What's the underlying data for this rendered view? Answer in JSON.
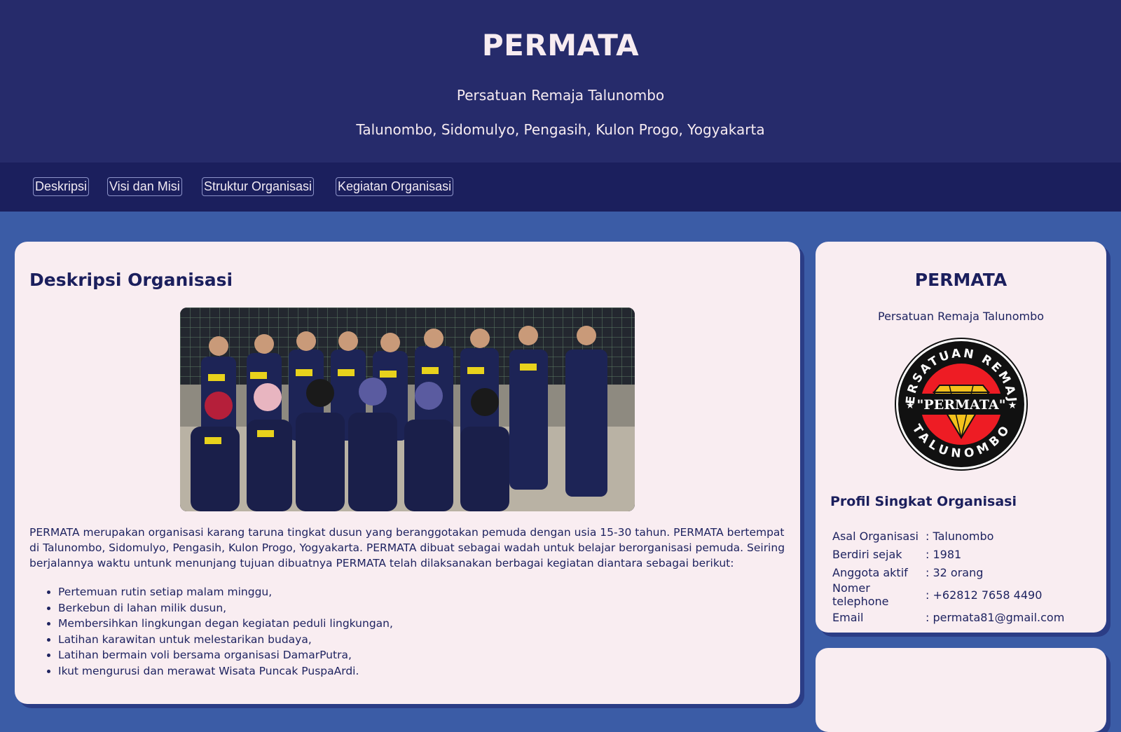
{
  "header": {
    "title": "PERMATA",
    "subtitle": "Persatuan Remaja Talunombo",
    "address": "Talunombo, Sidomulyo, Pengasih, Kulon Progo, Yogyakarta"
  },
  "nav": {
    "items": [
      {
        "label": "Deskripsi"
      },
      {
        "label": "Visi dan Misi"
      },
      {
        "label": "Struktur Organisasi"
      },
      {
        "label": "Kegiatan Organisasi"
      }
    ]
  },
  "main": {
    "title": "Deskripsi Organisasi",
    "description": "PERMATA merupakan organisasi karang taruna tingkat dusun yang beranggotakan pemuda dengan usia 15-30 tahun. PERMATA bertempat di Talunombo, Sidomulyo, Pengasih, Kulon Progo, Yogyakarta. PERMATA dibuat sebagai wadah untuk belajar berorganisasi pemuda. Seiring berjalannya waktu untunk menunjang tujuan dibuatnya PERMATA telah dilaksanakan berbagai kegiatan diantara sebagai berikut:",
    "activities": [
      "Pertemuan rutin setiap malam minggu,",
      "Berkebun di lahan milik dusun,",
      "Membersihkan lingkungan degan kegiatan peduli lingkungan,",
      "Latihan karawitan untuk melestarikan budaya,",
      "Latihan bermain voli bersama organisasi DamarPutra,",
      "Ikut mengurusi dan merawat Wisata Puncak PuspaArdi."
    ]
  },
  "sidebar": {
    "title": "PERMATA",
    "subtitle": "Persatuan Remaja Talunombo",
    "logo": {
      "ring_text_top": "PERSATUAN REMAJA",
      "ring_text_bottom": "TALUNOMBO",
      "center_text": "\"PERMATA\""
    },
    "profile_title": "Profil Singkat Organisasi",
    "profile": [
      {
        "key": "Asal Organisasi",
        "value": ": Talunombo"
      },
      {
        "key": "Berdiri sejak",
        "value": ": 1981"
      },
      {
        "key": "Anggota aktif",
        "value": ": 32 orang"
      },
      {
        "key": "Nomer telephone",
        "value": ": +62812 7658 4490"
      },
      {
        "key": "Email",
        "value": ": permata81@gmail.com"
      }
    ]
  },
  "colors": {
    "page_bg": "#3b5ca6",
    "header_bg": "#262b6b",
    "nav_bg": "#1b1f5d",
    "card_bg": "#f9edf1",
    "text": "#1e235e"
  }
}
